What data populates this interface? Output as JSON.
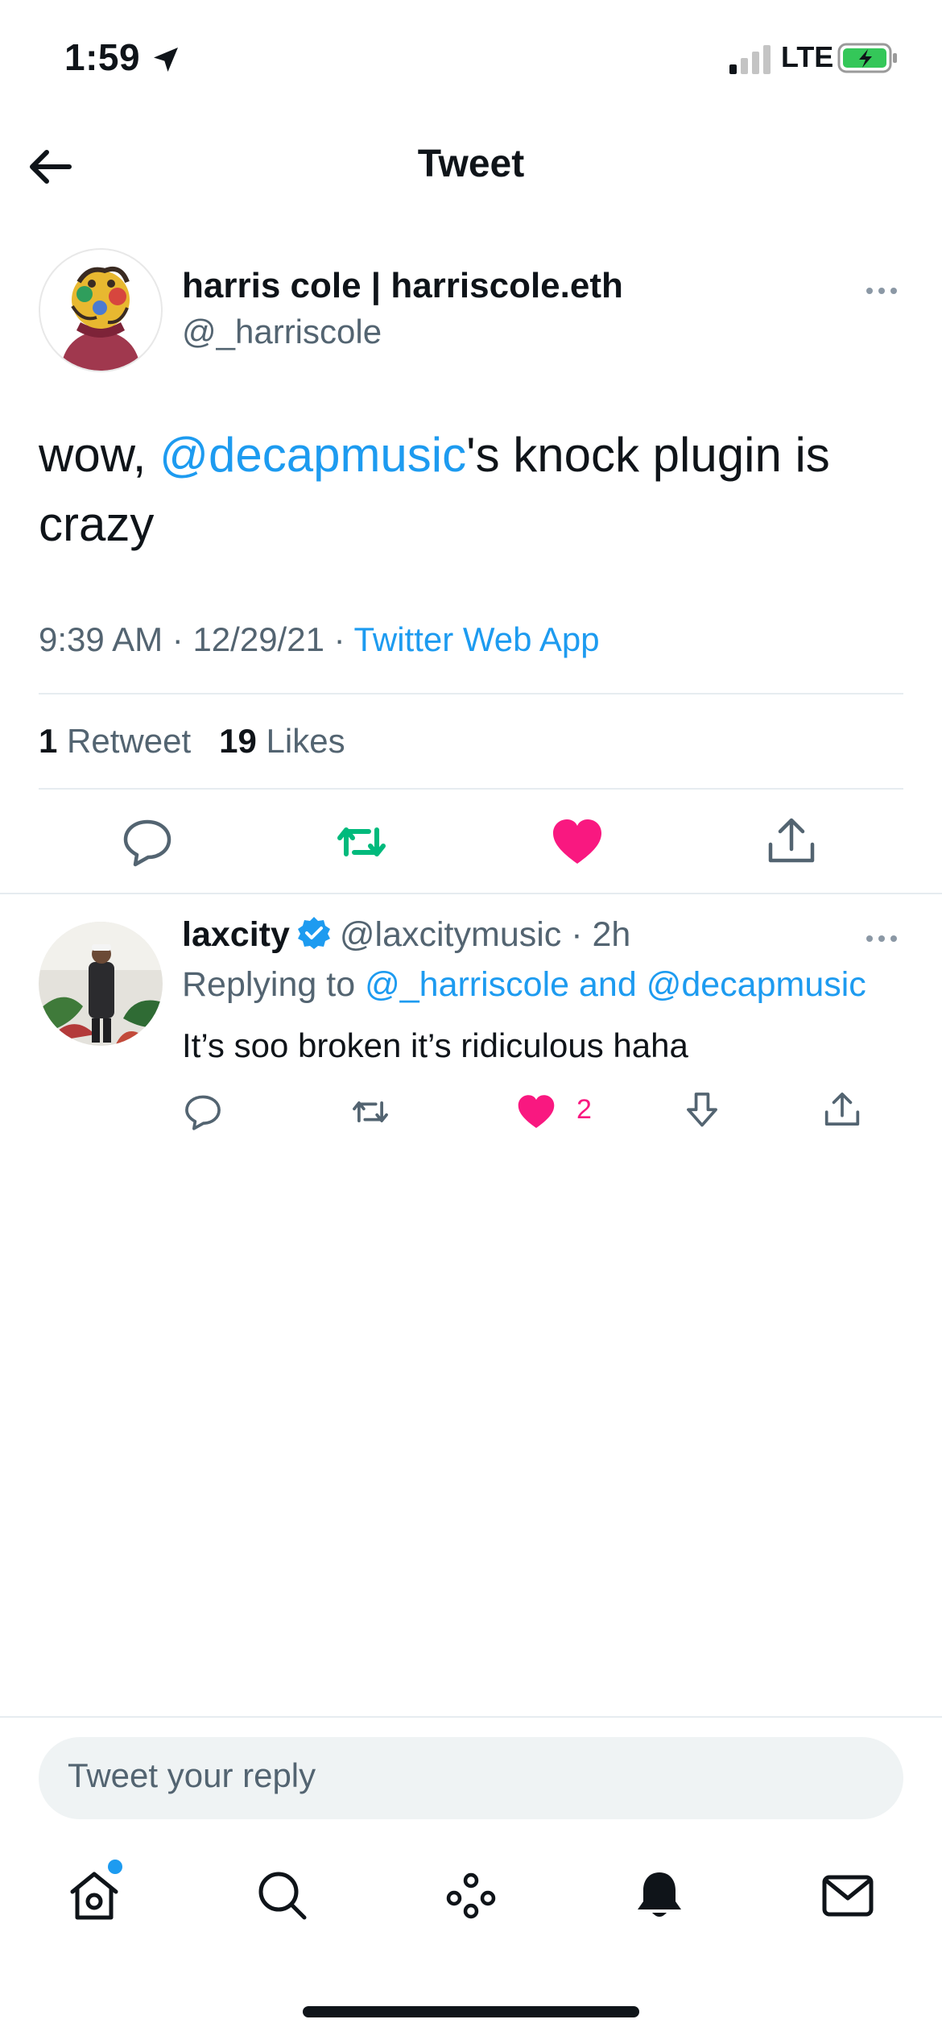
{
  "status_bar": {
    "time": "1:59",
    "network": "LTE",
    "icons": [
      "location-arrow-icon",
      "signal-icon",
      "battery-charging-icon"
    ]
  },
  "header": {
    "back_icon": "arrow-left-icon",
    "title": "Tweet"
  },
  "tweet": {
    "author_name": "harris cole | harriscole.eth",
    "author_handle": "@_harriscole",
    "text_pre": "wow, ",
    "mention": "@decapmusic",
    "text_post": "'s knock plugin is crazy",
    "time": "9:39 AM",
    "date": "12/29/21",
    "separator": "·",
    "source": "Twitter Web App",
    "retweet_count": "1",
    "retweet_label": "Retweet",
    "like_count": "19",
    "like_label": "Likes",
    "actions": [
      "reply-icon",
      "retweet-icon",
      "like-icon",
      "share-icon"
    ],
    "retweeted_color": "#00ba7c",
    "liked_color": "#f91880"
  },
  "reply": {
    "author_name": "laxcity",
    "author_handle": "@laxcitymusic",
    "separator": "·",
    "age": "2h",
    "replying_label": "Replying to",
    "replying_to": "@_harriscole and @decapmusic",
    "text": "It’s soo broken it’s ridiculous haha",
    "like_count": "2",
    "actions": [
      "reply-icon",
      "retweet-icon",
      "like-icon",
      "downvote-icon",
      "share-icon"
    ]
  },
  "composer": {
    "placeholder": "Tweet your reply"
  },
  "tab_bar": {
    "items": [
      "home-icon",
      "search-icon",
      "spaces-icon",
      "notifications-icon",
      "messages-icon"
    ]
  },
  "colors": {
    "accent": "#1d9bf0",
    "like": "#f91880",
    "retweet": "#00ba7c",
    "secondary_text": "#536471"
  }
}
